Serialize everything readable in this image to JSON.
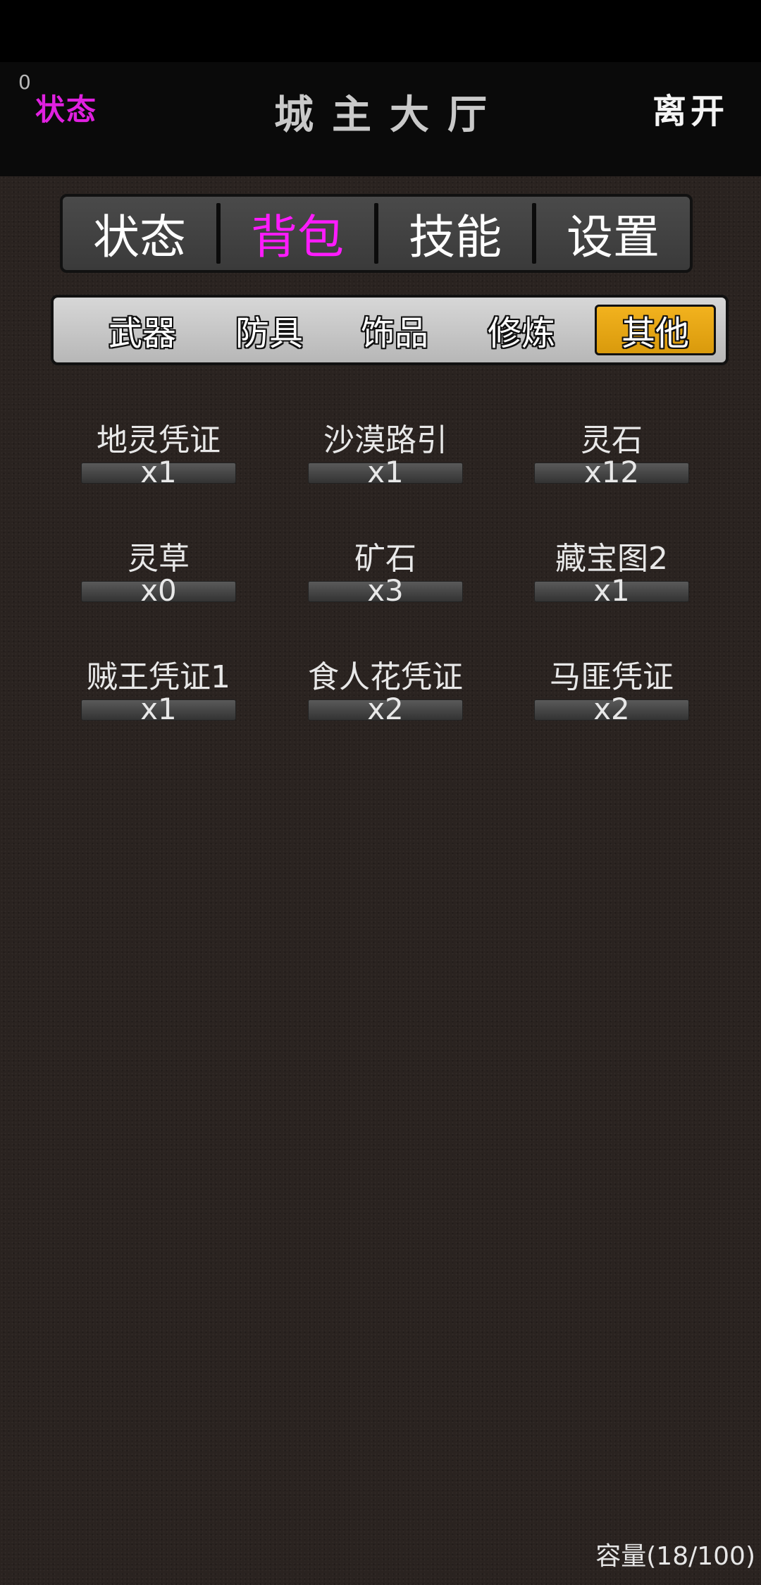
{
  "header": {
    "coin": "0",
    "status_link": "状态",
    "title": "城主大厅",
    "leave": "离开"
  },
  "main_tabs": [
    {
      "label": "状态",
      "active": false
    },
    {
      "label": "背包",
      "active": true
    },
    {
      "label": "技能",
      "active": false
    },
    {
      "label": "设置",
      "active": false
    }
  ],
  "sub_tabs": [
    {
      "label": "武器",
      "active": false
    },
    {
      "label": "防具",
      "active": false
    },
    {
      "label": "饰品",
      "active": false
    },
    {
      "label": "修炼",
      "active": false
    },
    {
      "label": "其他",
      "active": true
    }
  ],
  "items": [
    {
      "name": "地灵凭证",
      "count": "x1"
    },
    {
      "name": "沙漠路引",
      "count": "x1"
    },
    {
      "name": "灵石",
      "count": "x12"
    },
    {
      "name": "灵草",
      "count": "x0"
    },
    {
      "name": "矿石",
      "count": "x3"
    },
    {
      "name": "藏宝图2",
      "count": "x1"
    },
    {
      "name": "贼王凭证1",
      "count": "x1"
    },
    {
      "name": "食人花凭证",
      "count": "x2"
    },
    {
      "name": "马匪凭证",
      "count": "x2"
    }
  ],
  "footer": {
    "capacity": "容量(18/100)"
  },
  "colors": {
    "active_tab": "#ff1bff",
    "status_link": "#e020e0",
    "active_subtab": "#f2b21e",
    "background": "#2a2320"
  }
}
